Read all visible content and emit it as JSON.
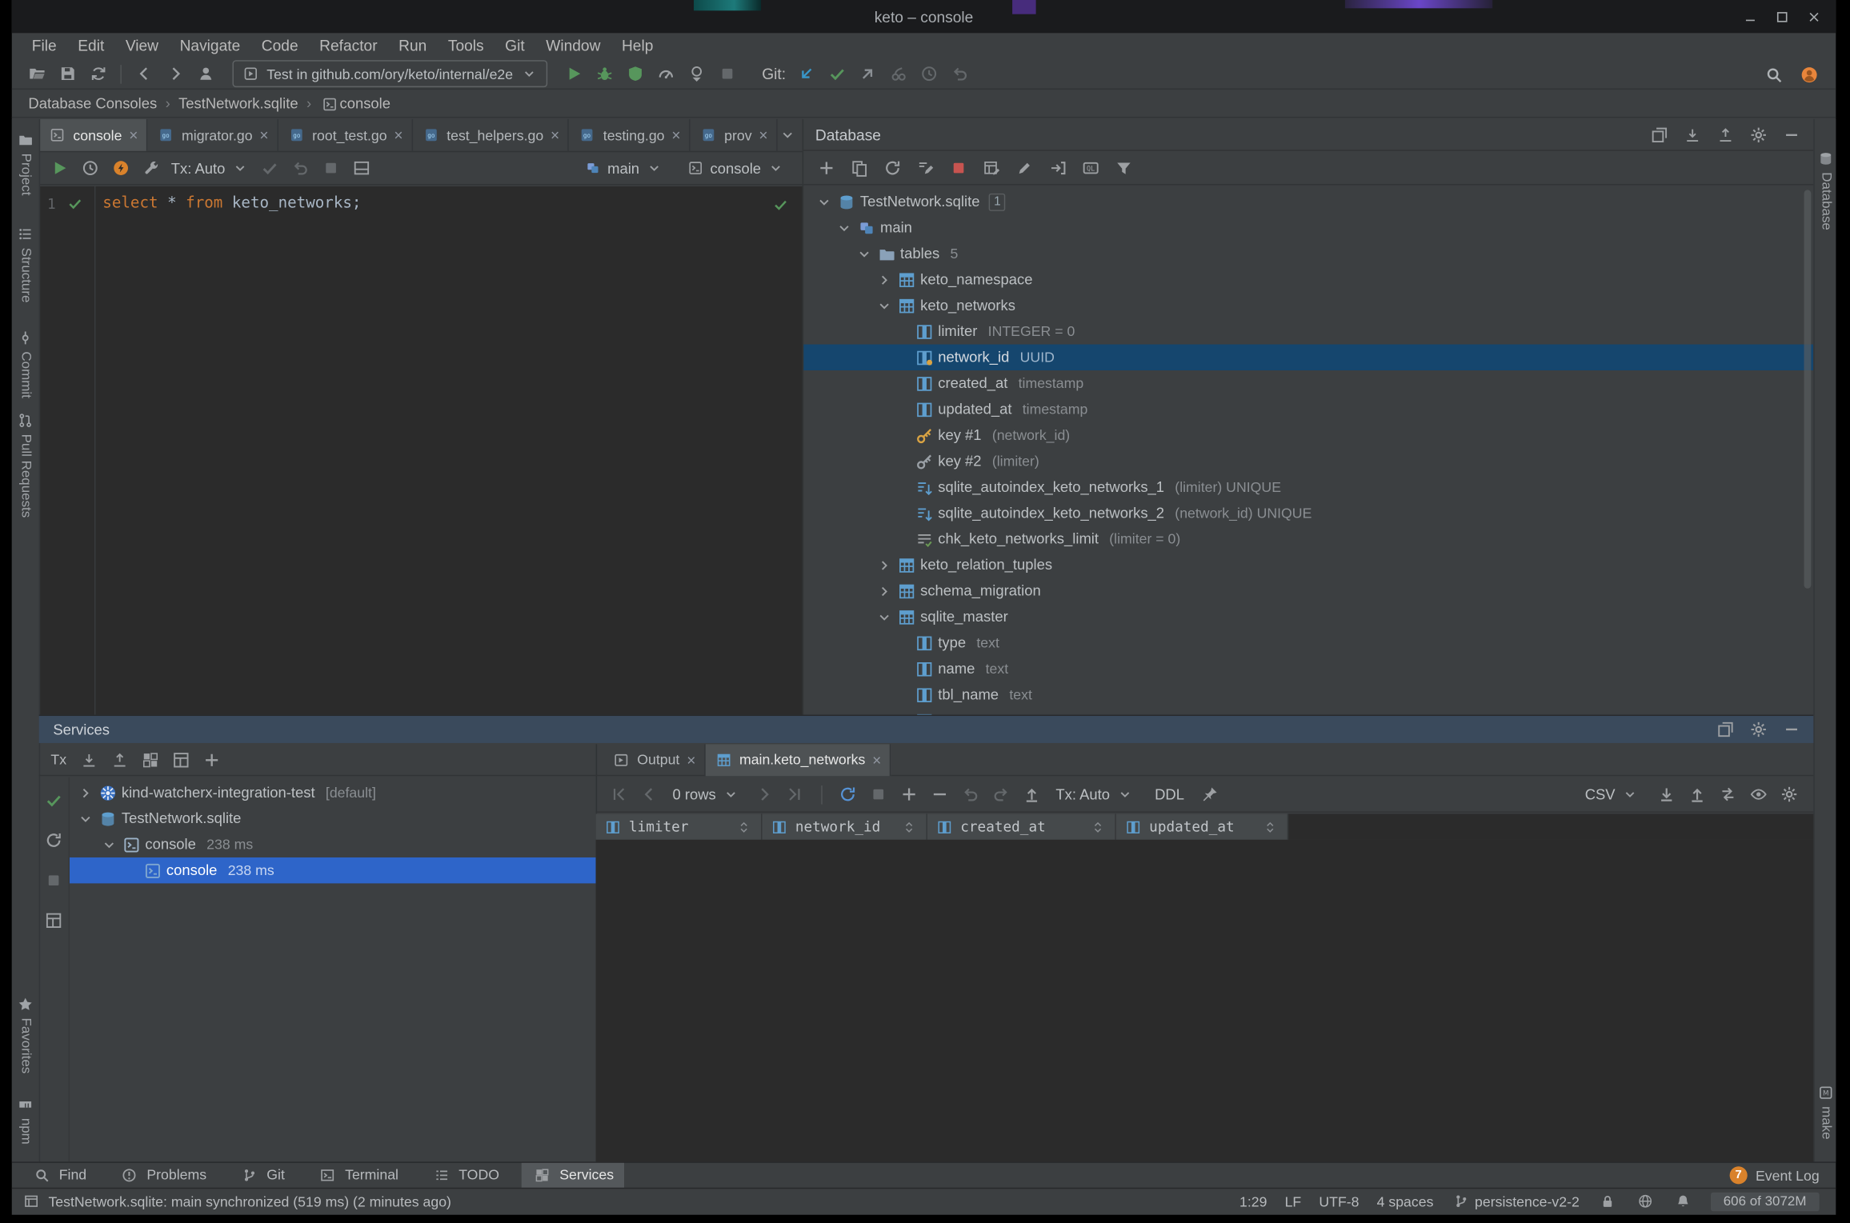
{
  "colors": {
    "selection_active": "#2E65C9",
    "selection_inactive": "#15466E",
    "run_green": "#57965C",
    "error_red": "#C75450",
    "keyword_orange": "#CC7832",
    "event_badge_orange": "#D9822B",
    "avatar_orange": "#E8853B"
  },
  "titlebar": {
    "title": "keto – console",
    "controls": [
      {
        "n": "win-min"
      },
      {
        "n": "win-max"
      },
      {
        "n": "win-close"
      }
    ]
  },
  "menubar": {
    "items": [
      "File",
      "Edit",
      "View",
      "Navigate",
      "Code",
      "Refactor",
      "Run",
      "Tools",
      "Git",
      "Window",
      "Help"
    ]
  },
  "toolbar": {
    "file_icons": [
      {
        "n": "open-folder"
      },
      {
        "n": "save"
      },
      {
        "n": "sync"
      }
    ],
    "nav_icons": [
      {
        "n": "back"
      },
      {
        "n": "forward"
      },
      {
        "n": "profile"
      }
    ],
    "run_config": "Test in github.com/ory/keto/internal/e2e",
    "run_icons": [
      {
        "n": "run",
        "c": "#57965C"
      },
      {
        "n": "debug",
        "c": "#57965C"
      },
      {
        "n": "coverage",
        "c": "#57965C"
      },
      {
        "n": "profiler",
        "c": "#9DA0A3"
      },
      {
        "n": "run-dropdown",
        "c": "#9DA0A3"
      },
      {
        "n": "stop",
        "c": "#64686B"
      }
    ],
    "git_label": "Git:",
    "git_icons": [
      {
        "n": "git-update",
        "c": "#3896C8"
      },
      {
        "n": "git-commit",
        "c": "#57965C"
      },
      {
        "n": "git-push",
        "c": "#8A8F94"
      },
      {
        "n": "cherry-pick",
        "c": "#64686B"
      },
      {
        "n": "history-clock",
        "c": "#64686B"
      },
      {
        "n": "rollback",
        "c": "#64686B"
      }
    ],
    "right_icons": [
      {
        "n": "search",
        "c": "#AFB3B6"
      },
      {
        "n": "avatar",
        "c": "#E8853B"
      }
    ]
  },
  "breadcrumb": {
    "items": [
      {
        "label": "Database Consoles"
      },
      {
        "label": "TestNetwork.sqlite"
      },
      {
        "label": "console",
        "icon": "console-file"
      }
    ]
  },
  "editor_tabs": [
    {
      "icon": "console-file",
      "label": "console",
      "active": true
    },
    {
      "icon": "go-file",
      "label": "migrator.go"
    },
    {
      "icon": "go-file",
      "label": "root_test.go"
    },
    {
      "icon": "go-file",
      "label": "test_helpers.go"
    },
    {
      "icon": "go-file",
      "label": "testing.go"
    },
    {
      "icon": "go-file",
      "label": "prov"
    }
  ],
  "console_toolbar": {
    "icons_a": [
      {
        "n": "run",
        "c": "#57965C"
      },
      {
        "n": "history-clock",
        "c": "#9DA0A3"
      },
      {
        "n": "plan",
        "c": "#D9822B"
      },
      {
        "n": "wrench",
        "c": "#9DA0A3"
      }
    ],
    "tx_label": "Tx: Auto",
    "icons_b": [
      {
        "n": "check",
        "c": "#64686B"
      },
      {
        "n": "rollback",
        "c": "#64686B"
      },
      {
        "n": "stop",
        "c": "#64686B"
      },
      {
        "n": "output-layout",
        "c": "#9DA0A3"
      }
    ],
    "schema_label": "main",
    "session_label": "console"
  },
  "editor": {
    "line_number": "1",
    "sql": "select * from keto_networks;",
    "tokens": [
      {
        "t": "select",
        "c": "kw"
      },
      {
        "t": " * ",
        "c": "pl"
      },
      {
        "t": "from",
        "c": "kw"
      },
      {
        "t": " keto_networks;",
        "c": "pl"
      }
    ]
  },
  "database_panel": {
    "title": "Database",
    "header_icons": [
      {
        "n": "float"
      },
      {
        "n": "expand-all"
      },
      {
        "n": "collapse-all"
      },
      {
        "n": "gear"
      },
      {
        "n": "minimize"
      }
    ],
    "toolbar_icons": [
      {
        "n": "add"
      },
      {
        "n": "copy"
      },
      {
        "n": "refresh"
      },
      {
        "n": "edit-source"
      },
      {
        "n": "stop",
        "c": "#C75450"
      },
      {
        "n": "table-editor"
      },
      {
        "n": "pencil"
      },
      {
        "n": "goto"
      },
      {
        "n": "ql-console"
      },
      {
        "n": "filter"
      }
    ],
    "tree": [
      {
        "indent": 0,
        "chevron": "down",
        "icon": "db-sqlite",
        "label": "TestNetwork.sqlite",
        "badge": "1"
      },
      {
        "indent": 1,
        "chevron": "down",
        "icon": "schema-stack",
        "label": "main"
      },
      {
        "indent": 2,
        "chevron": "down",
        "icon": "folder",
        "label": "tables",
        "meta": "5"
      },
      {
        "indent": 3,
        "chevron": "right",
        "icon": "table",
        "label": "keto_namespace"
      },
      {
        "indent": 3,
        "chevron": "down",
        "icon": "table",
        "label": "keto_networks"
      },
      {
        "indent": 4,
        "icon": "column",
        "label": "limiter",
        "meta": "INTEGER = 0"
      },
      {
        "indent": 4,
        "icon": "column-key",
        "label": "network_id",
        "meta": "UUID",
        "selected": true
      },
      {
        "indent": 4,
        "icon": "column",
        "label": "created_at",
        "meta": "timestamp"
      },
      {
        "indent": 4,
        "icon": "column",
        "label": "updated_at",
        "meta": "timestamp"
      },
      {
        "indent": 4,
        "icon": "key-gold",
        "label": "key #1",
        "meta": "(network_id)"
      },
      {
        "indent": 4,
        "icon": "key-gray",
        "label": "key #2",
        "meta": "(limiter)"
      },
      {
        "indent": 4,
        "icon": "index",
        "label": "sqlite_autoindex_keto_networks_1",
        "meta": "(limiter) UNIQUE"
      },
      {
        "indent": 4,
        "icon": "index",
        "label": "sqlite_autoindex_keto_networks_2",
        "meta": "(network_id) UNIQUE"
      },
      {
        "indent": 4,
        "icon": "constraint",
        "label": "chk_keto_networks_limit",
        "meta": "(limiter = 0)"
      },
      {
        "indent": 3,
        "chevron": "right",
        "icon": "table",
        "label": "keto_relation_tuples"
      },
      {
        "indent": 3,
        "chevron": "right",
        "icon": "table",
        "label": "schema_migration"
      },
      {
        "indent": 3,
        "chevron": "down",
        "icon": "table",
        "label": "sqlite_master"
      },
      {
        "indent": 4,
        "icon": "column",
        "label": "type",
        "meta": "text"
      },
      {
        "indent": 4,
        "icon": "column",
        "label": "name",
        "meta": "text"
      },
      {
        "indent": 4,
        "icon": "column",
        "label": "tbl_name",
        "meta": "text"
      },
      {
        "indent": 4,
        "icon": "column",
        "label": ""
      }
    ]
  },
  "services_panel": {
    "title": "Services",
    "tx_label": "Tx",
    "toolbar_icons": [
      {
        "n": "expand-all"
      },
      {
        "n": "collapse-all"
      },
      {
        "n": "group"
      },
      {
        "n": "layout"
      },
      {
        "n": "add"
      }
    ],
    "side_icons": [
      {
        "n": "check",
        "c": "#57965C"
      },
      {
        "n": "rerun"
      },
      {
        "n": "stop",
        "c": "#64686B"
      },
      {
        "n": "grid"
      }
    ],
    "header_icons": [
      {
        "n": "float"
      },
      {
        "n": "gear"
      },
      {
        "n": "minimize"
      }
    ],
    "tree": [
      {
        "indent": 0,
        "chevron": "right",
        "icon": "k8s",
        "label": "kind-watcherx-integration-test",
        "meta": "[default]"
      },
      {
        "indent": 0,
        "chevron": "down",
        "icon": "db-sqlite",
        "label": "TestNetwork.sqlite"
      },
      {
        "indent": 1,
        "chevron": "down",
        "icon": "session",
        "label": "console",
        "meta": "238 ms"
      },
      {
        "indent": 2,
        "icon": "console-run",
        "label": "console",
        "meta": "238 ms",
        "selected": true
      }
    ],
    "tabs": [
      {
        "icon": "output",
        "label": "Output"
      },
      {
        "icon": "table",
        "label": "main.keto_networks",
        "active": true
      }
    ],
    "grid": {
      "nav_a": [
        {
          "n": "first",
          "c": "#64686B"
        },
        {
          "n": "prev",
          "c": "#64686B"
        }
      ],
      "rows_label": "0 rows",
      "nav_b": [
        {
          "n": "next",
          "c": "#64686B"
        },
        {
          "n": "last",
          "c": "#64686B"
        }
      ],
      "action_icons": [
        {
          "n": "refresh",
          "c": "#5693D6"
        },
        {
          "n": "stop",
          "c": "#64686B"
        },
        {
          "n": "add-row"
        },
        {
          "n": "delete-row"
        },
        {
          "n": "undo",
          "c": "#64686B"
        },
        {
          "n": "redo",
          "c": "#64686B"
        },
        {
          "n": "submit"
        }
      ],
      "tx_label": "Tx: Auto",
      "ddl_label": "DDL",
      "csv_label": "CSV",
      "right_icons": [
        {
          "n": "download"
        },
        {
          "n": "upload"
        },
        {
          "n": "transpose"
        },
        {
          "n": "eye"
        },
        {
          "n": "gear"
        }
      ],
      "columns": [
        "limiter",
        "network_id",
        "created_at",
        "updated_at"
      ]
    }
  },
  "bottom_bar": {
    "buttons": [
      {
        "icon": "search",
        "label": "Find"
      },
      {
        "icon": "problems",
        "label": "Problems"
      },
      {
        "icon": "git-vcs",
        "label": "Git"
      },
      {
        "icon": "terminal",
        "label": "Terminal"
      },
      {
        "icon": "todo",
        "label": "TODO"
      },
      {
        "icon": "services",
        "label": "Services",
        "active": true
      }
    ],
    "event_log": {
      "badge": "7",
      "label": "Event Log"
    }
  },
  "status_bar": {
    "message": "TestNetwork.sqlite: main synchronized (519 ms) (2 minutes ago)",
    "caret": "1:29",
    "line_sep": "LF",
    "encoding": "UTF-8",
    "indent": "4 spaces",
    "branch": "persistence-v2-2",
    "memory": "606 of 3072M"
  },
  "stripes": {
    "left_top": [
      {
        "icon": "project",
        "label": "Project"
      },
      {
        "icon": "structure",
        "label": "Structure"
      },
      {
        "icon": "commit-tw",
        "label": "Commit"
      },
      {
        "icon": "pull-requests",
        "label": "Pull Requests"
      }
    ],
    "left_bottom": [
      {
        "icon": "star",
        "label": "Favorites"
      },
      {
        "icon": "npm",
        "label": "npm"
      }
    ],
    "right_top": [
      {
        "icon": "db-sqlite",
        "label": "Database"
      }
    ],
    "right_bottom": [
      {
        "icon": "make",
        "label": "make"
      }
    ]
  }
}
